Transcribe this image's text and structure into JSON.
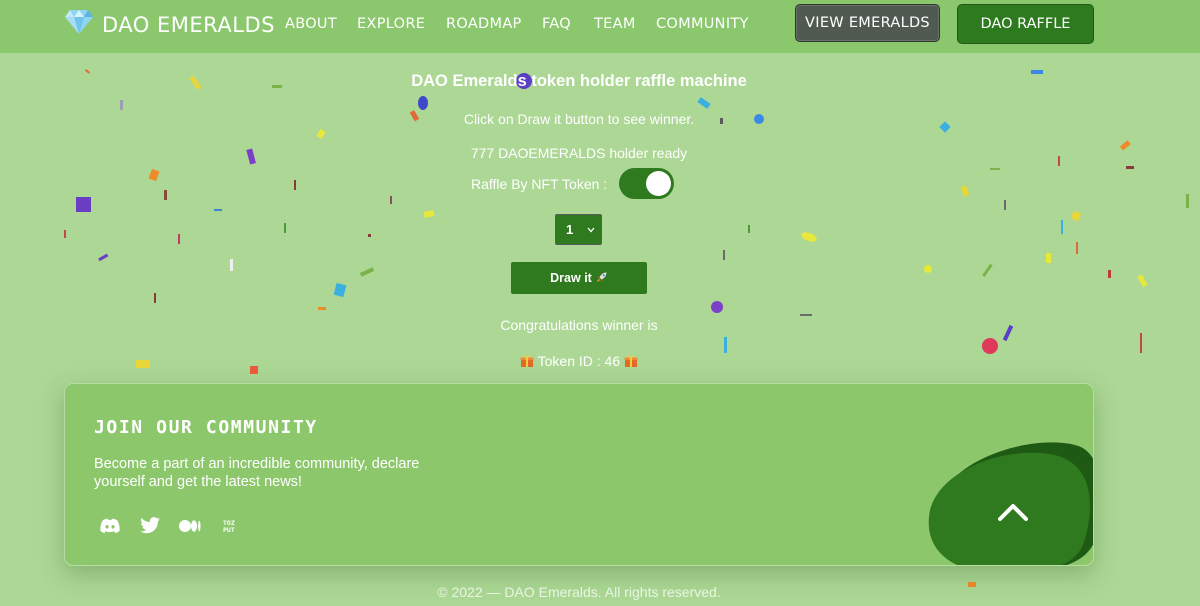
{
  "nav": {
    "logo_text": "DAO EMERALDS",
    "links": [
      "ABOUT",
      "EXPLORE",
      "ROADMAP",
      "FAQ",
      "TEAM",
      "COMMUNITY"
    ],
    "view_button": "VIEW EMERALDS",
    "raffle_button": "DAO RAFFLE"
  },
  "raffle": {
    "title": "DAO Emeralds token holder raffle machine",
    "instruction": "Click on Draw it button to see winner.",
    "holders": "777 DAOEMERALDS holder ready",
    "toggle_label": "Raffle By NFT Token :",
    "toggle_on": true,
    "select_value": "1",
    "draw_label": "Draw it",
    "winner_text": "Congratulations winner is",
    "token_text": "Token ID : 46"
  },
  "community": {
    "heading": "JOIN OUR COMMUNITY",
    "description": "Become a part of an incredible community, declare yourself and get the latest news!",
    "socials": [
      "discord-icon",
      "twitter-icon",
      "medium-icon",
      "hoc-icon"
    ]
  },
  "footer": {
    "copyright": "© 2022 — DAO Emeralds. All rights reserved."
  },
  "colors": {
    "background": "#acd795",
    "nav": "#8bc76c",
    "primary_green": "#2f7a1f",
    "dark_button": "#505a50"
  }
}
